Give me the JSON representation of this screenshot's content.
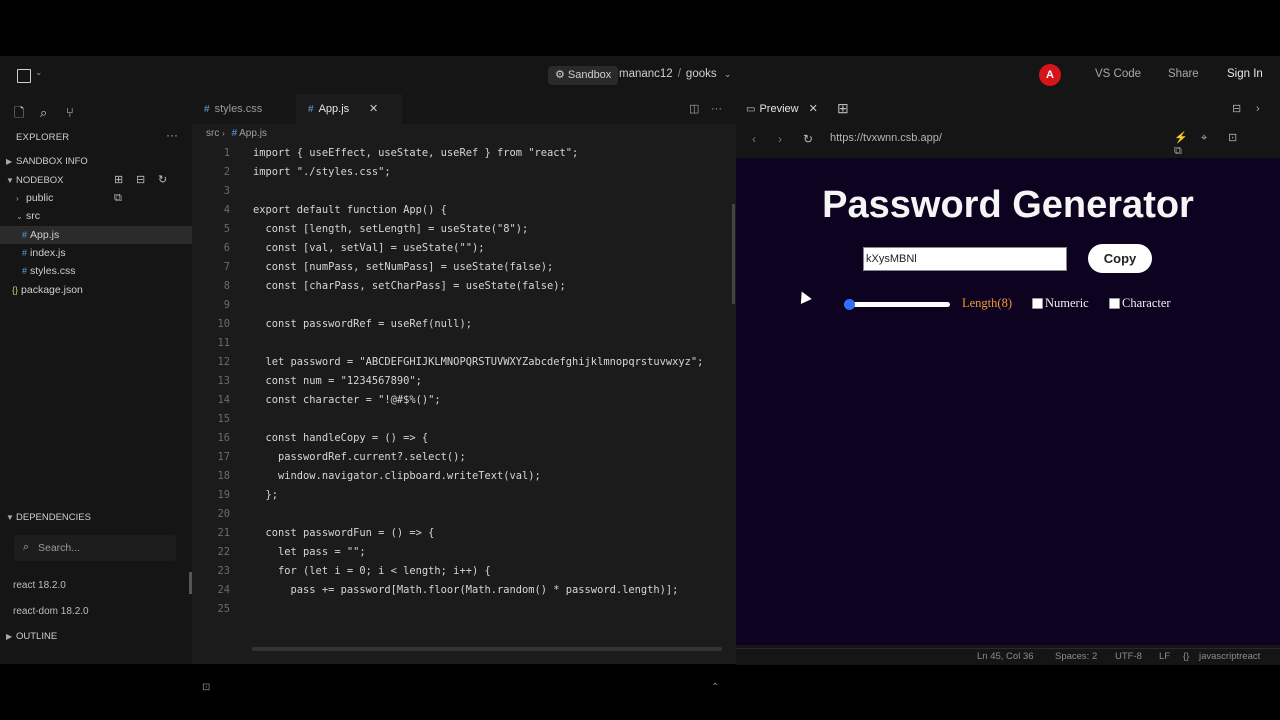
{
  "topbar": {
    "sandbox_label": "Sandbox",
    "owner": "mananc12",
    "separator": "/",
    "project": "gooks",
    "avatar_letter": "A",
    "vscode": "VS Code",
    "share": "Share",
    "signin": "Sign In"
  },
  "sidebar": {
    "explorer": "EXPLORER",
    "sandbox_info": "SANDBOX INFO",
    "nodebox": "NODEBOX",
    "tree": [
      "public",
      "src",
      "App.js",
      "index.js",
      "styles.css",
      "package.json"
    ],
    "dependencies": "DEPENDENCIES",
    "search_placeholder": "Search...",
    "deps": [
      "react 18.2.0",
      "react-dom 18.2.0"
    ],
    "outline": "OUTLINE"
  },
  "editor": {
    "tabs": [
      "styles.css",
      "App.js"
    ],
    "breadcrumb_dir": "src",
    "breadcrumb_file": "App.js",
    "lines": [
      {
        "n": "1",
        "t": "import { useEffect, useState, useRef } from \"react\";"
      },
      {
        "n": "2",
        "t": "import \"./styles.css\";"
      },
      {
        "n": "3",
        "t": ""
      },
      {
        "n": "4",
        "t": "export default function App() {"
      },
      {
        "n": "5",
        "t": "  const [length, setLength] = useState(\"8\");"
      },
      {
        "n": "6",
        "t": "  const [val, setVal] = useState(\"\");"
      },
      {
        "n": "7",
        "t": "  const [numPass, setNumPass] = useState(false);"
      },
      {
        "n": "8",
        "t": "  const [charPass, setCharPass] = useState(false);"
      },
      {
        "n": "9",
        "t": ""
      },
      {
        "n": "10",
        "t": "  const passwordRef = useRef(null);"
      },
      {
        "n": "11",
        "t": ""
      },
      {
        "n": "12",
        "t": "  let password = \"ABCDEFGHIJKLMNOPQRSTUVWXYZabcdefghijklmnopqrstuvwxyz\";"
      },
      {
        "n": "13",
        "t": "  const num = \"1234567890\";"
      },
      {
        "n": "14",
        "t": "  const character = \"!@#$%()\";"
      },
      {
        "n": "15",
        "t": ""
      },
      {
        "n": "16",
        "t": "  const handleCopy = () => {"
      },
      {
        "n": "17",
        "t": "    passwordRef.current?.select();"
      },
      {
        "n": "18",
        "t": "    window.navigator.clipboard.writeText(val);"
      },
      {
        "n": "19",
        "t": "  };"
      },
      {
        "n": "20",
        "t": ""
      },
      {
        "n": "21",
        "t": "  const passwordFun = () => {"
      },
      {
        "n": "22",
        "t": "    let pass = \"\";"
      },
      {
        "n": "23",
        "t": "    for (let i = 0; i < length; i++) {"
      },
      {
        "n": "24",
        "t": "      pass += password[Math.floor(Math.random() * password.length)];"
      },
      {
        "n": "25",
        "t": ""
      }
    ]
  },
  "preview": {
    "tab_label": "Preview",
    "url": "https://tvxwnn.csb.app/",
    "title": "Password Generator",
    "password_value": "kXysMBNl",
    "copy_label": "Copy",
    "length_label": "Length(8)",
    "slider_fraction": 0.0,
    "numeric_label": "Numeric",
    "numeric_checked": false,
    "character_label": "Character",
    "character_checked": false
  },
  "status": {
    "position": "Ln 45, Col 36",
    "spaces": "Spaces: 2",
    "encoding": "UTF-8",
    "eol": "LF",
    "language": "javascriptreact"
  }
}
